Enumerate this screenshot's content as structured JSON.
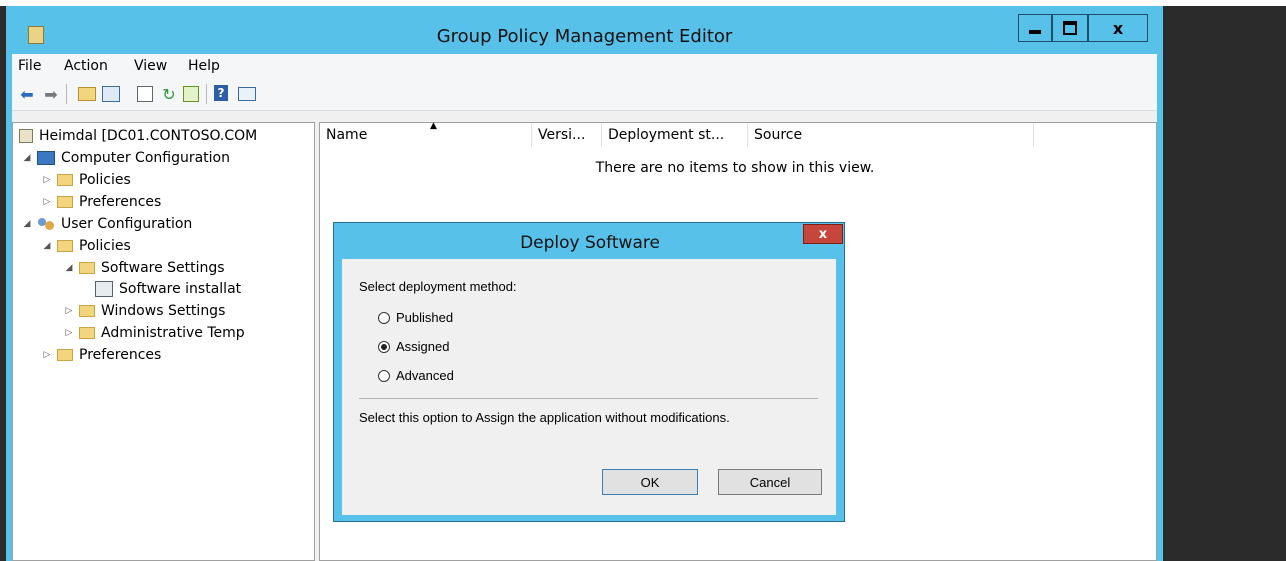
{
  "window": {
    "title": "Group Policy Management Editor",
    "close_glyph": "x"
  },
  "menu": [
    "File",
    "Action",
    "View",
    "Help"
  ],
  "toolbar": {
    "icons": [
      "back-arrow-icon",
      "forward-arrow-icon",
      "up-folder-icon",
      "show-hide-tree-icon",
      "properties-icon",
      "refresh-icon",
      "export-list-icon",
      "help-icon",
      "show-action-pane-icon"
    ],
    "help_glyph": "?"
  },
  "tree": {
    "root": "Heimdal [DC01.CONTOSO.COM",
    "computer_config": "Computer Configuration",
    "cc_policies": "Policies",
    "cc_preferences": "Preferences",
    "user_config": "User Configuration",
    "uc_policies": "Policies",
    "software_settings": "Software Settings",
    "software_installation": "Software installat",
    "windows_settings": "Windows Settings",
    "admin_templates": "Administrative Temp",
    "uc_preferences": "Preferences"
  },
  "list": {
    "columns": [
      "Name",
      "Versi...",
      "Deployment st...",
      "Source"
    ],
    "empty_message": "There are no items to show in this view."
  },
  "dialog": {
    "title": "Deploy Software",
    "close_glyph": "x",
    "prompt": "Select deployment method:",
    "options": [
      "Published",
      "Assigned",
      "Advanced"
    ],
    "selected": "Assigned",
    "description": "Select this option to Assign the application without modifications.",
    "ok_label": "OK",
    "cancel_label": "Cancel"
  },
  "colors": {
    "window_frame": "#58c1ea",
    "dialog_close": "#c7463b",
    "background": "#2b2b2b"
  }
}
